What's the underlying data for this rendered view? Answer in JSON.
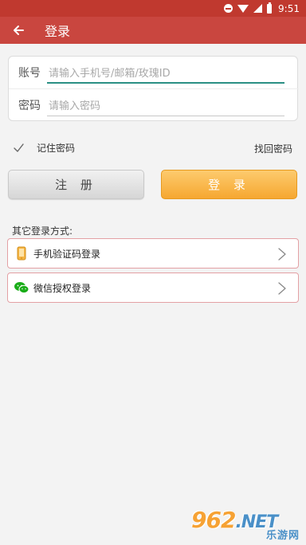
{
  "status_bar": {
    "time": "9:51"
  },
  "header": {
    "title": "登录"
  },
  "form": {
    "account_label": "账号",
    "account_placeholder": "请输入手机号/邮箱/玫瑰ID",
    "password_label": "密码",
    "password_placeholder": "请输入密码"
  },
  "options": {
    "remember_label": "记住密码",
    "remember_checked": true,
    "forgot_label": "找回密码"
  },
  "buttons": {
    "register_label": "注 册",
    "login_label": "登 录"
  },
  "other_login": {
    "title": "其它登录方式:",
    "items": [
      {
        "label": "手机验证码登录",
        "icon": "phone-icon"
      },
      {
        "label": "微信授权登录",
        "icon": "wechat-icon"
      }
    ]
  },
  "watermark": {
    "logo_text": "962",
    "logo_suffix": ".NET",
    "sub_text": "乐游网"
  },
  "colors": {
    "header": "#c9463f",
    "status_bar": "#c0392f",
    "login_button": "#f6a731",
    "input_focus": "#2a8f84",
    "item_border": "#e3a0a4"
  }
}
